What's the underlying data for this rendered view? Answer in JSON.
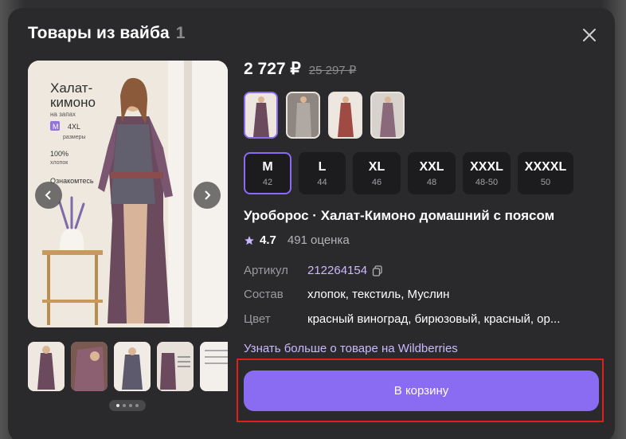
{
  "modal": {
    "title": "Товары из вайба",
    "count": "1"
  },
  "gallery": {
    "main_image": {
      "headline_line1": "Халат-",
      "headline_line2": "кимоно",
      "subtitle": "на запах",
      "size_from": "M",
      "size_to": "4XL",
      "sizes_label": "размеры",
      "material_percent": "100%",
      "material": "хлопок",
      "note": "Ознакомтесь"
    },
    "thumbnails_count": 5,
    "current_page": 1,
    "pages": 4
  },
  "product": {
    "price": "2 727 ₽",
    "old_price": "25 297 ₽",
    "name": "Уроборос · Халат-Кимоно домашний с поясом",
    "rating": "4.7",
    "reviews": "491 оценка",
    "specs": [
      {
        "key": "Артикул",
        "value": "212264154"
      },
      {
        "key": "Состав",
        "value": "хлопок, текстиль, Муслин"
      },
      {
        "key": "Цвет",
        "value": "красный виноград, бирюзовый, красный, ор..."
      }
    ],
    "more_link": "Узнать больше о товаре на Wildberries",
    "cart_button": "В корзину"
  },
  "sizes": [
    {
      "size": "M",
      "num": "42",
      "selected": true
    },
    {
      "size": "L",
      "num": "44"
    },
    {
      "size": "XL",
      "num": "46"
    },
    {
      "size": "XXL",
      "num": "48"
    },
    {
      "size": "XXXL",
      "num": "48-50"
    },
    {
      "size": "XXXXL",
      "num": "50"
    }
  ],
  "colors": {
    "accent": "#8a6cf2",
    "link": "#c9baff",
    "highlight": "#e11e1e"
  }
}
